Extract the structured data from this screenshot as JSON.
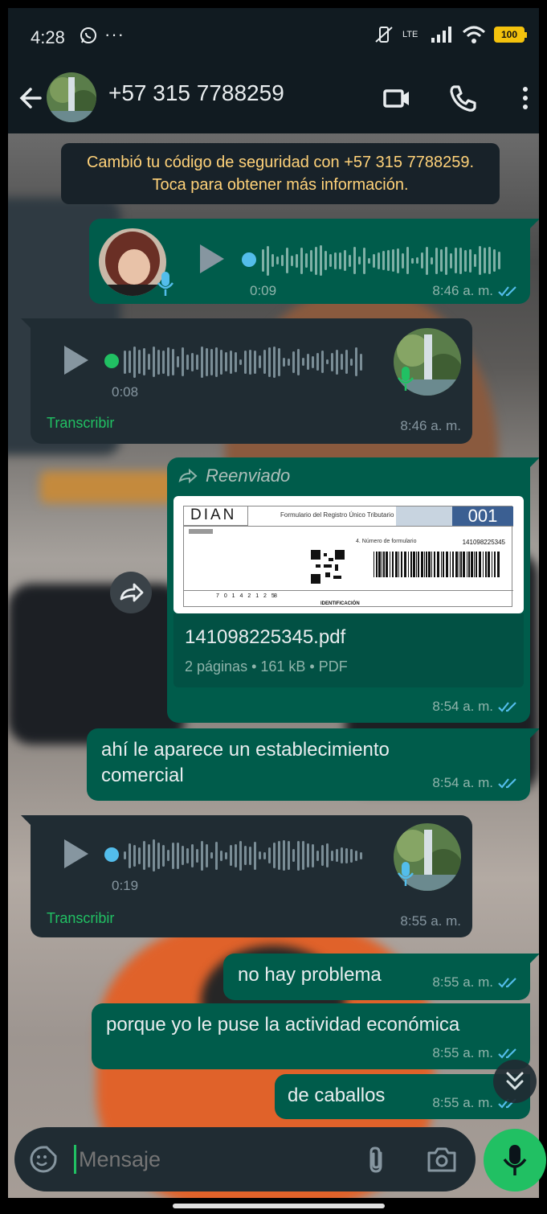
{
  "status_bar": {
    "time": "4:28",
    "more": "···",
    "battery": "100",
    "network": "LTE"
  },
  "header": {
    "contact": "+57 315 7788259"
  },
  "system_message": "Cambió tu código de seguridad con +57 315 7788259. Toca para obtener más información.",
  "messages": [
    {
      "type": "voice",
      "direction": "outgoing",
      "duration": "0:09",
      "time": "8:46 a. m.",
      "read": true
    },
    {
      "type": "voice",
      "direction": "incoming",
      "duration": "0:08",
      "time": "8:46 a. m.",
      "transcribe": "Transcribir"
    },
    {
      "type": "document",
      "direction": "outgoing",
      "forwarded_label": "Reenviado",
      "filename": "141098225345.pdf",
      "details": "2 páginas • 161 kB • PDF",
      "time": "8:54 a. m.",
      "read": true,
      "preview": {
        "logo": "DIAN",
        "form_title": "Formulario del Registro Único Tributario",
        "form_number": "001",
        "form_field": "4. Número de formulario",
        "form_value": "141098225345",
        "nit_digits": "7 0 1 4 2 1 2 5",
        "nit_dv": "8",
        "section": "IDENTIFICACIÓN"
      }
    },
    {
      "type": "text",
      "direction": "outgoing",
      "lines": [
        "ahí le aparece un establecimiento",
        "comercial"
      ],
      "time": "8:54 a. m.",
      "read": true
    },
    {
      "type": "voice",
      "direction": "incoming",
      "duration": "0:19",
      "time": "8:55 a. m.",
      "transcribe": "Transcribir"
    },
    {
      "type": "text",
      "direction": "outgoing",
      "text": "no hay problema",
      "time": "8:55 a. m.",
      "read": true
    },
    {
      "type": "text",
      "direction": "outgoing",
      "text": "porque yo le puse la actividad económica",
      "time": "8:55 a. m.",
      "read": true
    },
    {
      "type": "text",
      "direction": "outgoing",
      "text": "de caballos",
      "time": "8:55 a. m.",
      "read": true
    }
  ],
  "input": {
    "placeholder": "Mensaje"
  },
  "colors": {
    "outgoing_bubble": "#005c4b",
    "incoming_bubble": "#202c33",
    "accent": "#21c063",
    "read_ticks": "#53bdeb"
  },
  "icons": [
    "back-arrow-icon",
    "video-call-icon",
    "phone-icon",
    "more-vert-icon",
    "play-icon",
    "mic-icon",
    "forward-icon",
    "emoji-sticker-icon",
    "attach-icon",
    "camera-icon",
    "chevron-double-down-icon"
  ]
}
